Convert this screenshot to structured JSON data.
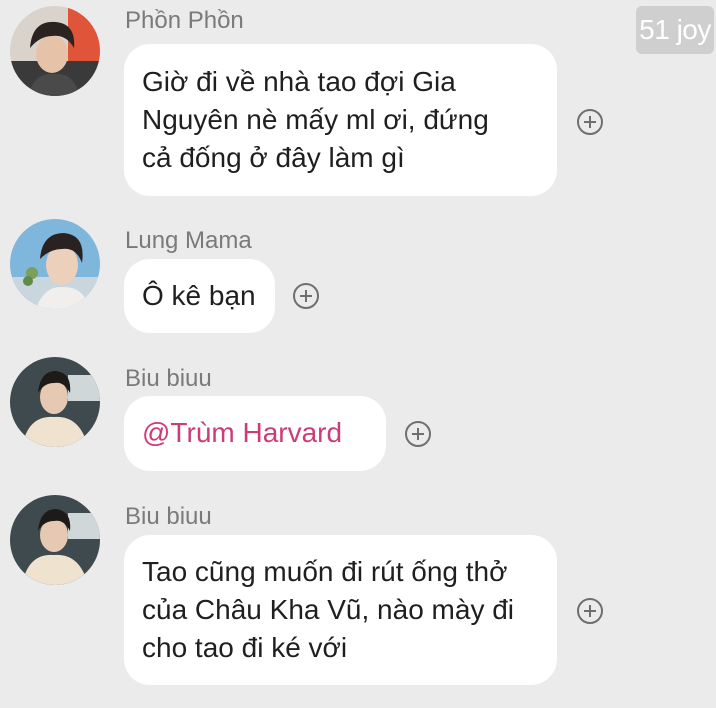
{
  "watermark": "51 joy",
  "messages": [
    {
      "sender": "Phồn Phồn",
      "lines": [
        "Giờ đi về nhà tao đợi Gia",
        "Nguyên nè mấy ml ơi, đứng",
        "cả đống ở đây làm gì"
      ],
      "avatar_icon": "avatar-phon-phon"
    },
    {
      "sender": "Lung Mama",
      "lines": [
        "Ô kê bạn"
      ],
      "avatar_icon": "avatar-lung-mama"
    },
    {
      "sender": "Biu biuu",
      "lines": [
        "@Trùm Harvard"
      ],
      "avatar_icon": "avatar-biu-biuu"
    },
    {
      "sender": "Biu biuu",
      "lines": [
        "Tao cũng muốn đi rút ống thở",
        "của Châu Kha Vũ, nào mày đi",
        "cho tao đi ké với"
      ],
      "avatar_icon": "avatar-biu-biuu"
    }
  ],
  "colors": {
    "background": "#ebebeb",
    "bubble": "#ffffff",
    "mention": "#cc3c7a",
    "sender": "#7a7a7a"
  },
  "react_icon": "add-reaction-icon"
}
